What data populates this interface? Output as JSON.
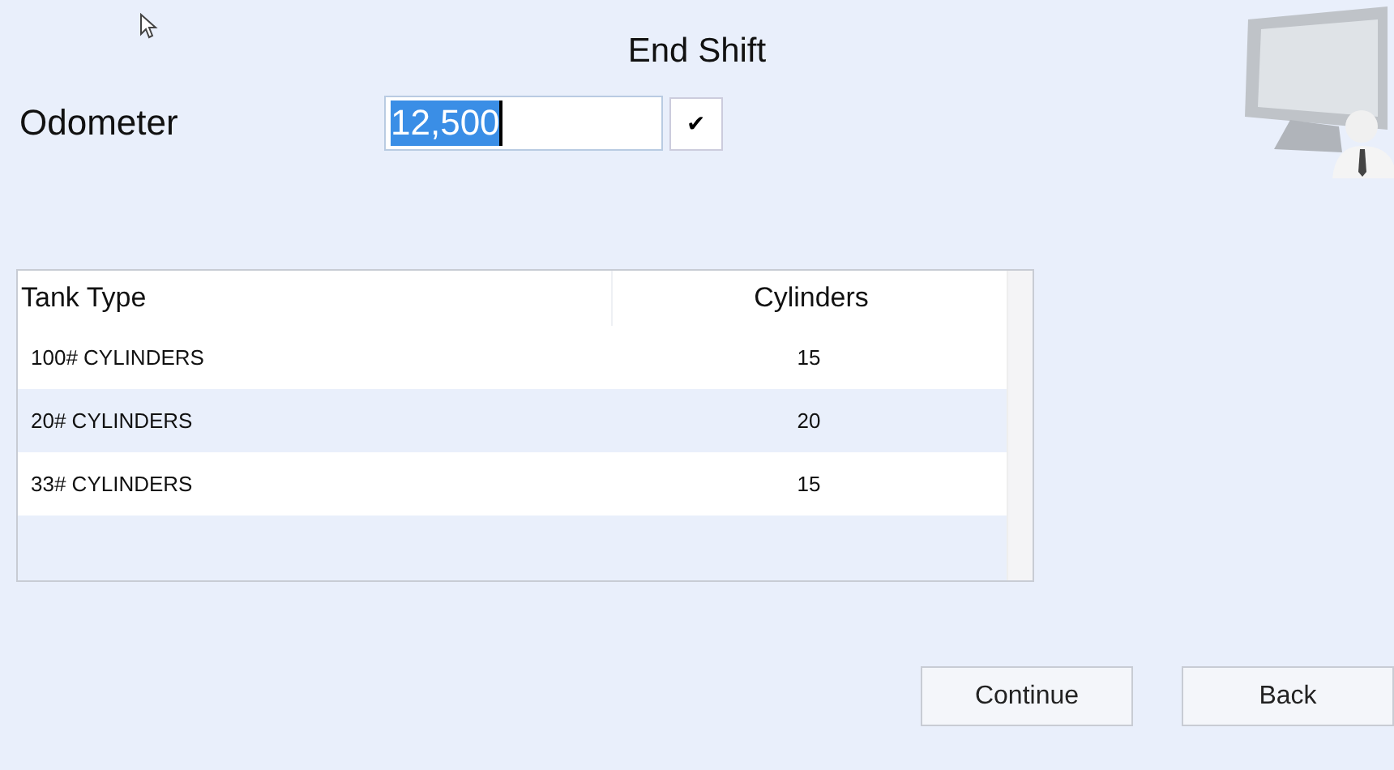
{
  "title": "End Shift",
  "odometer": {
    "label": "Odometer",
    "value": "12,500",
    "selected": true,
    "confirm_glyph": "✔"
  },
  "table": {
    "columns": [
      "Tank Type",
      "Cylinders"
    ],
    "rows": [
      {
        "tank_type": "100# CYLINDERS",
        "cylinders": "15"
      },
      {
        "tank_type": "20# CYLINDERS",
        "cylinders": "20"
      },
      {
        "tank_type": "33# CYLINDERS",
        "cylinders": "15"
      }
    ]
  },
  "buttons": [
    "Continue",
    "Back"
  ]
}
